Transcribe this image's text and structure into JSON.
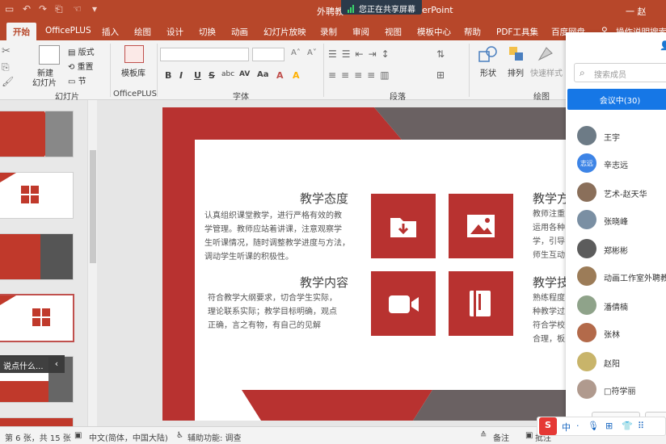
{
  "titlebar": {
    "title": "外聘教",
    "title_suffix": "erPoint",
    "share_banner": "您正在共享屏幕",
    "user": "一 赵",
    "min": "—"
  },
  "tabs": [
    "开始",
    "OfficePLUS",
    "插入",
    "绘图",
    "设计",
    "切换",
    "动画",
    "幻灯片放映",
    "录制",
    "审阅",
    "视图",
    "模板中心",
    "帮助",
    "PDF工具集",
    "百度网盘",
    "操作说明搜索"
  ],
  "ribbon": {
    "new_slide": "新建\n幻灯片",
    "new_slide_l1": "新建",
    "new_slide_l2": "幻灯片",
    "layout": "版式",
    "reset": "重置",
    "section": "节",
    "template_lib": "模板库",
    "shape": "形状",
    "arrange": "排列",
    "quick_style": "快速样式",
    "groups": {
      "slides": "幻灯片",
      "officeplus": "OfficePLUS",
      "font": "字体",
      "paragraph": "段落",
      "drawing": "绘图"
    },
    "format_buttons": [
      "B",
      "I",
      "U",
      "S",
      "abc",
      "AV",
      "Aa",
      "A",
      "A"
    ]
  },
  "slide": {
    "heading1": "教学态度",
    "body1": [
      "认真组织课堂教学，进行严格有效的教",
      "学管理。教师应站着讲课，注意观察学",
      "生听课情况，随时调整教学进度与方法，",
      "调动学生听课的积极性。"
    ],
    "heading2": "教学内容",
    "body2": [
      "符合教学大纲要求，切合学生实际，",
      "理论联系实际；教学目标明确，观点",
      "正确，言之有物，有自己的见解"
    ],
    "heading3": "教学方",
    "body3": [
      "教师注重",
      "运用各种",
      "学，引导",
      "师生互动"
    ],
    "heading4": "教学技",
    "body4": [
      "熟练程度",
      "种教学过",
      "符合学校",
      "合理，板"
    ]
  },
  "thumbs": {
    "tooltip": "说点什么...",
    "tooltip_btn": "‹"
  },
  "panel": {
    "search_placeholder": "搜索成员",
    "meeting_button": "会议中(30)",
    "members": [
      {
        "name": "王宇",
        "color": "#6d7b86"
      },
      {
        "name": "辛志远",
        "color": "#3d84e6",
        "avatar_text": "志远"
      },
      {
        "name": "艺术-赵天华",
        "color": "#8a6f5a"
      },
      {
        "name": "张晓峰",
        "color": "#7a8fa3"
      },
      {
        "name": "郑彬彬",
        "color": "#5c5c5c"
      },
      {
        "name": "动画工作室外聘教",
        "color": "#9c7c58"
      },
      {
        "name": "潘倩楠",
        "color": "#8fa38a"
      },
      {
        "name": "张林",
        "color": "#b36a4a"
      },
      {
        "name": "赵阳",
        "color": "#c8b46a"
      },
      {
        "name": "□符学丽",
        "color": "#b09a8e"
      }
    ],
    "bottom_right": "解除"
  },
  "statusbar": {
    "slide_info": "第 6 张，共 15 张",
    "language": "中文(简体，中国大陆)",
    "accessibility": "辅助功能: 调查",
    "notes": "备注",
    "comments": "批注"
  },
  "ime": {
    "items": [
      "中",
      "·",
      "•",
      "⊞",
      "👕",
      "⠿"
    ]
  }
}
